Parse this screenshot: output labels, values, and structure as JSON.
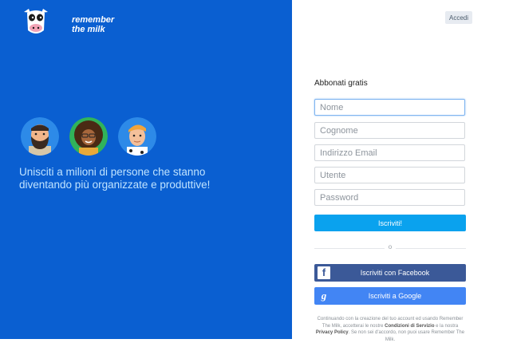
{
  "brand": {
    "line1": "remember",
    "line2": "the milk"
  },
  "hero": {
    "tagline": "Unisciti a milioni di persone che stanno diventando più organizzate e produttive!"
  },
  "header": {
    "login_label": "Accedi"
  },
  "signup": {
    "title": "Abbonati gratis",
    "first_name_placeholder": "Nome",
    "last_name_placeholder": "Cognome",
    "email_placeholder": "Indirizzo Email",
    "username_placeholder": "Utente",
    "password_placeholder": "Password",
    "submit_label": "Iscriviti!",
    "or_label": "o",
    "facebook_label": "Iscriviti con Facebook",
    "google_label": "Iscriviti a Google"
  },
  "legal": {
    "part1": "Continuando con la creazione del tuo account ed usando Remember The Milk, accetterai le nostre ",
    "terms_link": "Condizioni di Servizio",
    "part2": " e la nostra ",
    "privacy_link": "Privacy Policy",
    "part3": ". Se non sei d'accordo, non puoi usare Remember The Milk."
  },
  "colors": {
    "left_panel": "#0a5fd1",
    "primary_button": "#0aa2ee",
    "facebook": "#3b5998",
    "google": "#4285f4"
  }
}
